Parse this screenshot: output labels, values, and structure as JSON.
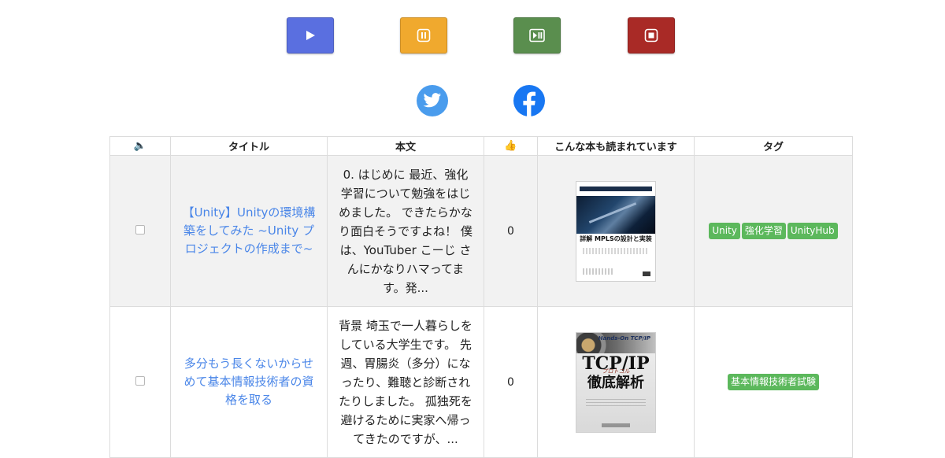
{
  "controls": {
    "play": {
      "color": "#5a6fe0"
    },
    "pause": {
      "color": "#f0a92e"
    },
    "play_pause": {
      "color": "#5a8e4e"
    },
    "stop": {
      "color": "#a92a26"
    }
  },
  "share": {
    "twitter_color": "#4a9ced",
    "facebook_color": "#1877f2"
  },
  "table": {
    "headers": {
      "speaker": "🔈",
      "title": "タイトル",
      "body": "本文",
      "likes": "👍",
      "books": "こんな本も読まれています",
      "tags": "タグ"
    },
    "rows": [
      {
        "title": "【Unity】Unityの環境構築をしてみた ~Unity プロジェクトの作成まで~",
        "excerpt": "0. はじめに 最近、強化学習について勉強をはじめました。 できたらかなり面白そうですよね！ 僕は、YouTuber こーじ さんにかなりハマってます。発...",
        "likes": "0",
        "book": {
          "title": "詳解 MPLSの設計と実装"
        },
        "tags": [
          "Unity",
          "強化学習",
          "UnityHub"
        ]
      },
      {
        "title": "多分もう長くないからせめて基本情報技術者の資格を取る",
        "excerpt": "背景 埼玉で一人暮らしをしている大学生です。 先週、胃腸炎（多分）になったり、難聴と診断されたりしました。 孤独死を避けるために実家へ帰ってきたのですが、...",
        "likes": "0",
        "book": {
          "series": "Hands-On TCP/IP",
          "big": "TCP/IP",
          "protocol": "プロトコル",
          "jp": "徹底解析"
        },
        "tags": [
          "基本情報技術者試験"
        ]
      }
    ]
  }
}
